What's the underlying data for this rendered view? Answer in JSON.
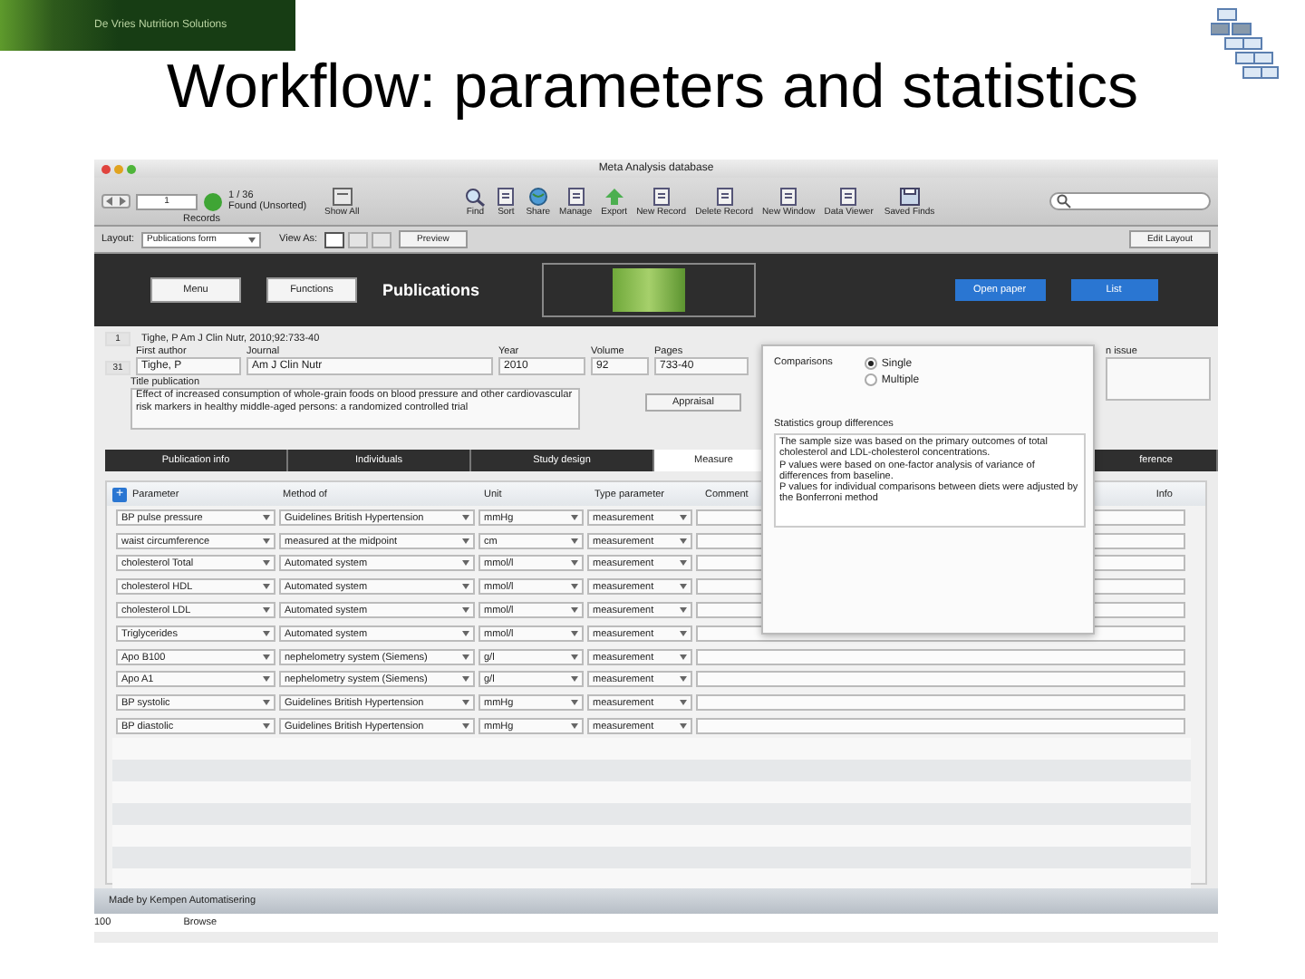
{
  "slide": {
    "brand": "De Vries Nutrition Solutions",
    "title": "Workflow: parameters and statistics"
  },
  "window": {
    "title": "Meta Analysis database"
  },
  "toolbar": {
    "record": "1",
    "count": "1 / 36",
    "found": "Found (Unsorted)",
    "records_label": "Records",
    "show_all": "Show All",
    "actions": [
      {
        "label": "Find",
        "kind": "find"
      },
      {
        "label": "Sort",
        "kind": "doc"
      },
      {
        "label": "Share",
        "kind": "globe"
      },
      {
        "label": "Manage",
        "kind": "doc"
      },
      {
        "label": "Export",
        "kind": "arrow"
      },
      {
        "label": "New Record",
        "kind": "doc"
      },
      {
        "label": "Delete Record",
        "kind": "doc"
      },
      {
        "label": "New Window",
        "kind": "doc"
      },
      {
        "label": "Data Viewer",
        "kind": "doc"
      }
    ],
    "saved": "Saved Finds"
  },
  "layout_bar": {
    "layout_label": "Layout:",
    "layout": "Publications form",
    "view_label": "View As:",
    "views": [
      {
        "selected": true
      },
      {
        "selected": false
      },
      {
        "selected": false
      }
    ],
    "preview": "Preview",
    "edit": "Edit Layout"
  },
  "header": {
    "buttons": [
      "Menu",
      "Functions"
    ],
    "title": "Publications",
    "open_paper": "Open paper",
    "list": "List"
  },
  "record": {
    "index": "1",
    "summary": "Tighe, P Am J Clin Nutr, 2010;92:733-40",
    "id": "31",
    "fields": [
      {
        "label": "First author",
        "value": "Tighe, P"
      },
      {
        "label": "Journal",
        "value": "Am J Clin Nutr"
      },
      {
        "label": "Year",
        "value": "2010"
      },
      {
        "label": "Volume",
        "value": "92"
      },
      {
        "label": "Pages",
        "value": "733-40"
      }
    ],
    "issue_label": "n issue",
    "title_label": "Title publication",
    "title_value": "Effect of increased consumption of whole-grain foods on blood pressure and other cardiovascular risk markers in healthy middle-aged persons: a randomized controlled trial",
    "appraisal": "Appraisal"
  },
  "tabs": [
    {
      "label": "Publication info",
      "selected": false
    },
    {
      "label": "Individuals",
      "selected": false
    },
    {
      "label": "Study design",
      "selected": false
    },
    {
      "label": "Measure",
      "selected": true
    },
    {
      "label": "ference",
      "selected": false
    }
  ],
  "popover": {
    "comparisons_label": "Comparisons",
    "options": [
      {
        "label": "Single",
        "selected": true
      },
      {
        "label": "Multiple",
        "selected": false
      }
    ],
    "stats_label": "Statistics group differences",
    "stats_text": "The sample size was based on the primary outcomes of total cholesterol and LDL-cholesterol concentrations.\nP values were based on one-factor analysis of variance of differences from baseline.\nP values for individual comparisons between diets were adjusted by the Bonferroni method"
  },
  "table": {
    "add": "+",
    "columns": [
      "Parameter",
      "Method of",
      "Unit",
      "Type parameter",
      "Comment",
      "Info"
    ],
    "rows": [
      {
        "parameter": "BP pulse pressure",
        "method": "Guidelines British Hypertension",
        "unit": "mmHg",
        "type": "measurement"
      },
      {
        "parameter": "waist circumference",
        "method": "measured at the midpoint",
        "unit": "cm",
        "type": "measurement"
      },
      {
        "parameter": "cholesterol Total",
        "method": "Automated system",
        "unit": "mmol/l",
        "type": "measurement"
      },
      {
        "parameter": "cholesterol HDL",
        "method": "Automated system",
        "unit": "mmol/l",
        "type": "measurement"
      },
      {
        "parameter": "cholesterol LDL",
        "method": "Automated system",
        "unit": "mmol/l",
        "type": "measurement"
      },
      {
        "parameter": "Triglycerides",
        "method": "Automated system",
        "unit": "mmol/l",
        "type": "measurement"
      },
      {
        "parameter": "Apo B100",
        "method": "nephelometry system (Siemens)",
        "unit": "g/l",
        "type": "measurement"
      },
      {
        "parameter": "Apo A1",
        "method": "nephelometry system (Siemens)",
        "unit": "g/l",
        "type": "measurement"
      },
      {
        "parameter": "BP systolic",
        "method": "Guidelines British Hypertension",
        "unit": "mmHg",
        "type": "measurement"
      },
      {
        "parameter": "BP diastolic",
        "method": "Guidelines British Hypertension",
        "unit": "mmHg",
        "type": "measurement"
      }
    ]
  },
  "footer": "Made by Kempen Automatisering",
  "status": {
    "zoom": "100",
    "mode": "Browse"
  }
}
